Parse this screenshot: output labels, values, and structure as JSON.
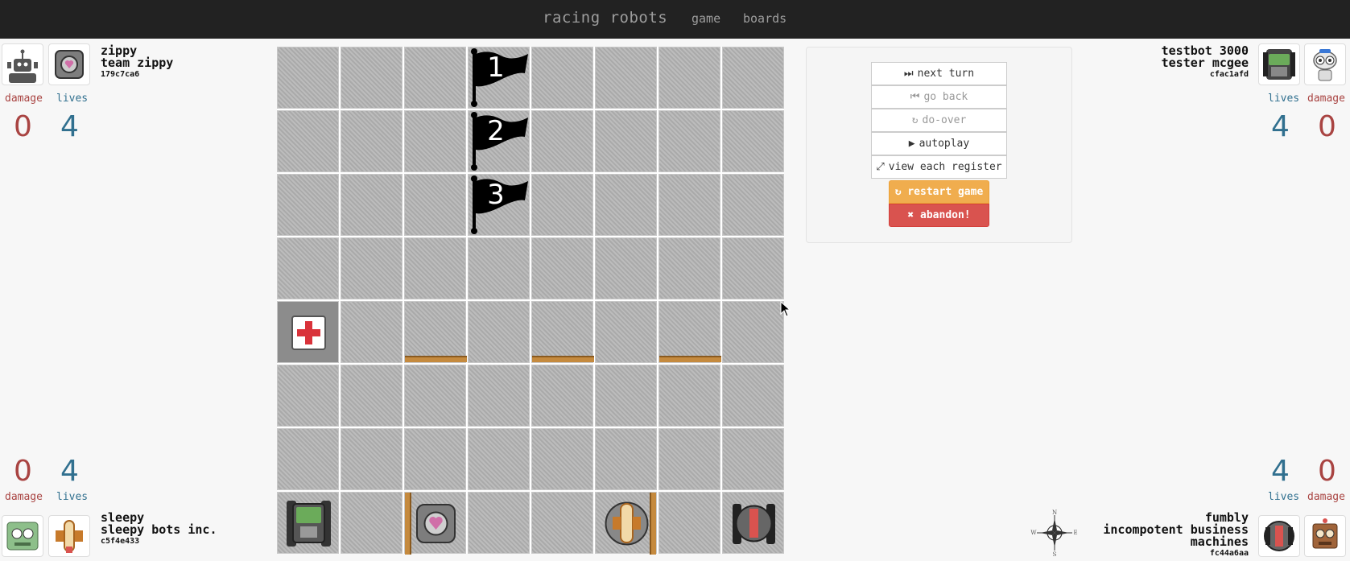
{
  "nav": {
    "brand": "racing robots",
    "links": [
      "game",
      "boards"
    ]
  },
  "players": {
    "top_left": {
      "name": "zippy",
      "team": "team zippy",
      "id": "179c7ca6",
      "damage_label": "damage",
      "lives_label": "lives",
      "damage": "0",
      "lives": "4"
    },
    "top_right": {
      "name": "testbot 3000",
      "team": "tester mcgee",
      "id": "cfac1afd",
      "damage_label": "damage",
      "lives_label": "lives",
      "damage": "0",
      "lives": "4"
    },
    "bottom_left": {
      "name": "sleepy",
      "team": "sleepy bots inc.",
      "id": "c5f4e433",
      "damage_label": "damage",
      "lives_label": "lives",
      "damage": "0",
      "lives": "4"
    },
    "bottom_right": {
      "name": "fumbly",
      "team_line1": "incompotent business",
      "team_line2": "machines",
      "id": "fc44a6aa",
      "damage_label": "damage",
      "lives_label": "lives",
      "damage": "0",
      "lives": "4"
    }
  },
  "board": {
    "flags": [
      "1",
      "2",
      "3"
    ]
  },
  "controls": {
    "next_turn": "next turn",
    "go_back": "go back",
    "do_over": "do-over",
    "autoplay": "autoplay",
    "view_each_register": "view each register",
    "restart_game": "restart game",
    "abandon": "abandon!"
  },
  "compass": {
    "n": "N",
    "s": "S",
    "e": "E",
    "w": "W"
  },
  "colors": {
    "navbar": "#222222",
    "damage": "#a94442",
    "lives": "#31708f",
    "warning": "#f0ad4e",
    "danger": "#d9534f"
  }
}
